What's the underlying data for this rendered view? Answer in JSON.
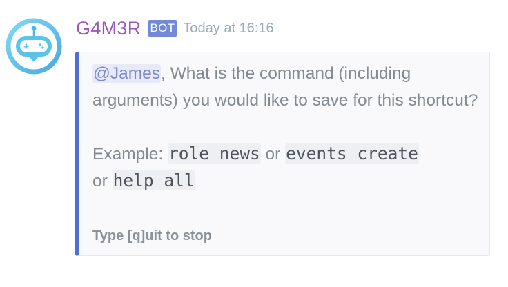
{
  "message": {
    "author": {
      "name": "G4M3R",
      "tag": "BOT",
      "avatar_icon": "gamepad-robot-icon",
      "name_color": "#9b59b6"
    },
    "timestamp": "Today at 16:16",
    "embed": {
      "accent_color": "#4f6fd6",
      "mention": "@James",
      "question": ", What is the command (including arguments) you would like to save for this shortcut?",
      "example_prefix": "Example: ",
      "example_1": "role news",
      "or_1": " or ",
      "example_2": "events create",
      "or_2": "or ",
      "example_3": "help all",
      "footer": "Type [q]uit to stop"
    }
  }
}
